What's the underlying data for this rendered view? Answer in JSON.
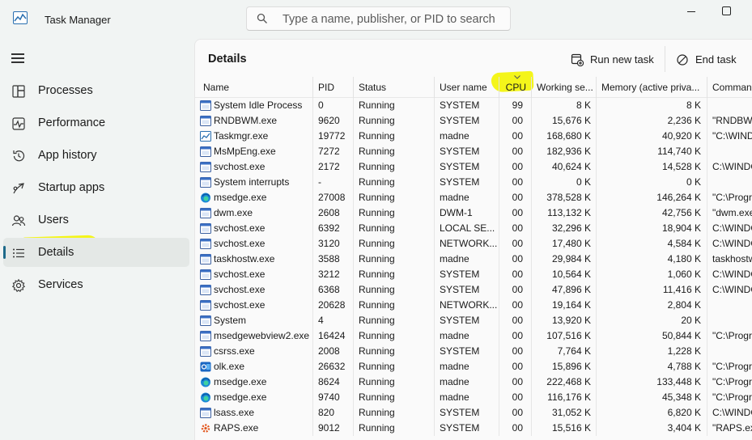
{
  "app": {
    "title": "Task Manager"
  },
  "search": {
    "placeholder": "Type a name, publisher, or PID to search"
  },
  "sidebar": {
    "items": [
      {
        "label": "Processes",
        "icon": "processes-icon"
      },
      {
        "label": "Performance",
        "icon": "performance-icon"
      },
      {
        "label": "App history",
        "icon": "app-history-icon"
      },
      {
        "label": "Startup apps",
        "icon": "startup-apps-icon"
      },
      {
        "label": "Users",
        "icon": "users-icon"
      },
      {
        "label": "Details",
        "icon": "details-icon",
        "active": true
      },
      {
        "label": "Services",
        "icon": "services-icon"
      }
    ]
  },
  "main": {
    "title": "Details",
    "run_new_task": "Run new task",
    "end_task": "End task"
  },
  "table": {
    "columns": [
      "Name",
      "PID",
      "Status",
      "User name",
      "CPU",
      "Working se...",
      "Memory (active priva...",
      "Comman"
    ],
    "sorted_column": "CPU",
    "rows": [
      [
        "System Idle Process",
        "0",
        "Running",
        "SYSTEM",
        "99",
        "8 K",
        "8 K",
        ""
      ],
      [
        "RNDBWM.exe",
        "9620",
        "Running",
        "SYSTEM",
        "00",
        "15,676 K",
        "2,236 K",
        "\"RNDBWM"
      ],
      [
        "Taskmgr.exe",
        "19772",
        "Running",
        "madne",
        "00",
        "168,680 K",
        "40,920 K",
        "\"C:\\WIND"
      ],
      [
        "MsMpEng.exe",
        "7272",
        "Running",
        "SYSTEM",
        "00",
        "182,936 K",
        "114,740 K",
        ""
      ],
      [
        "svchost.exe",
        "2172",
        "Running",
        "SYSTEM",
        "00",
        "40,624 K",
        "14,528 K",
        "C:\\WINDO"
      ],
      [
        "System interrupts",
        "-",
        "Running",
        "SYSTEM",
        "00",
        "0 K",
        "0 K",
        ""
      ],
      [
        "msedge.exe",
        "27008",
        "Running",
        "madne",
        "00",
        "378,528 K",
        "146,264 K",
        "\"C:\\Progr"
      ],
      [
        "dwm.exe",
        "2608",
        "Running",
        "DWM-1",
        "00",
        "113,132 K",
        "42,756 K",
        "\"dwm.exe"
      ],
      [
        "svchost.exe",
        "6392",
        "Running",
        "LOCAL SE...",
        "00",
        "32,296 K",
        "18,904 K",
        "C:\\WINDO"
      ],
      [
        "svchost.exe",
        "3120",
        "Running",
        "NETWORK...",
        "00",
        "17,480 K",
        "4,584 K",
        "C:\\WINDO"
      ],
      [
        "taskhostw.exe",
        "3588",
        "Running",
        "madne",
        "00",
        "29,984 K",
        "4,180 K",
        "taskhostw"
      ],
      [
        "svchost.exe",
        "3212",
        "Running",
        "SYSTEM",
        "00",
        "10,564 K",
        "1,060 K",
        "C:\\WINDO"
      ],
      [
        "svchost.exe",
        "6368",
        "Running",
        "SYSTEM",
        "00",
        "47,896 K",
        "11,416 K",
        "C:\\WINDO"
      ],
      [
        "svchost.exe",
        "20628",
        "Running",
        "NETWORK...",
        "00",
        "19,164 K",
        "2,804 K",
        ""
      ],
      [
        "System",
        "4",
        "Running",
        "SYSTEM",
        "00",
        "13,920 K",
        "20 K",
        ""
      ],
      [
        "msedgewebview2.exe",
        "16424",
        "Running",
        "madne",
        "00",
        "107,516 K",
        "50,844 K",
        "\"C:\\Progr"
      ],
      [
        "csrss.exe",
        "2008",
        "Running",
        "SYSTEM",
        "00",
        "7,764 K",
        "1,228 K",
        ""
      ],
      [
        "olk.exe",
        "26632",
        "Running",
        "madne",
        "00",
        "15,896 K",
        "4,788 K",
        "\"C:\\Progr"
      ],
      [
        "msedge.exe",
        "8624",
        "Running",
        "madne",
        "00",
        "222,468 K",
        "133,448 K",
        "\"C:\\Progr"
      ],
      [
        "msedge.exe",
        "9740",
        "Running",
        "madne",
        "00",
        "116,176 K",
        "45,348 K",
        "\"C:\\Progr"
      ],
      [
        "lsass.exe",
        "820",
        "Running",
        "SYSTEM",
        "00",
        "31,052 K",
        "6,820 K",
        "C:\\WINDO"
      ],
      [
        "RAPS.exe",
        "9012",
        "Running",
        "SYSTEM",
        "00",
        "15,516 K",
        "3,404 K",
        "\"RAPS.exe"
      ]
    ],
    "row_icons": [
      "window-icon",
      "window-icon",
      "taskmgr-icon",
      "window-icon",
      "window-icon",
      "window-icon",
      "edge-icon",
      "window-icon",
      "window-icon",
      "window-icon",
      "window-icon",
      "window-icon",
      "window-icon",
      "window-icon",
      "window-icon",
      "window-icon",
      "window-icon",
      "outlook-icon",
      "edge-icon",
      "edge-icon",
      "window-icon",
      "raps-icon"
    ]
  },
  "colors": {
    "highlight": "#f4f51a",
    "accent": "#1e6a8a"
  }
}
